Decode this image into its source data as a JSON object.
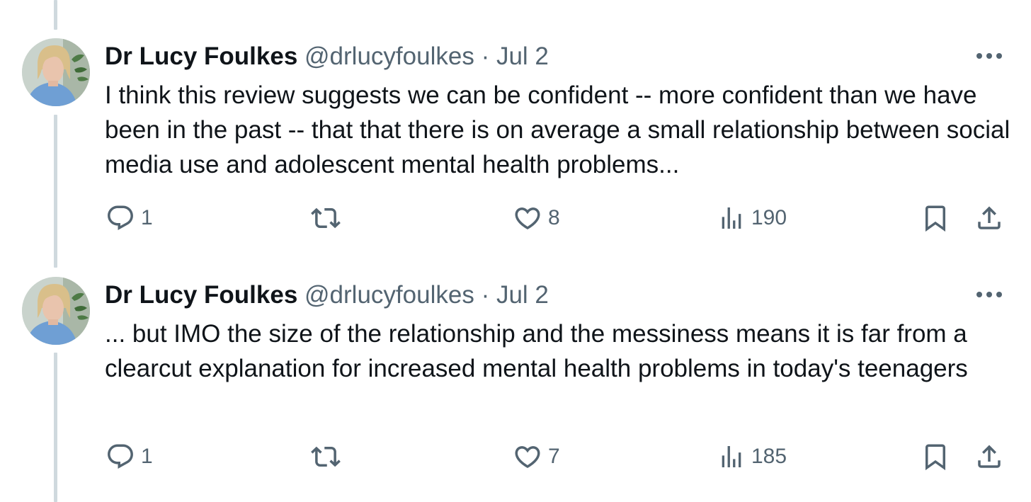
{
  "colors": {
    "text_primary": "#0f1419",
    "text_secondary": "#536471",
    "thread_line": "#cfd9de",
    "background": "#ffffff"
  },
  "icons": {
    "reply": "reply-icon",
    "retweet": "retweet-icon",
    "like": "heart-icon",
    "views": "views-icon",
    "bookmark": "bookmark-icon",
    "share": "share-icon",
    "more": "more-icon"
  },
  "tweets": [
    {
      "author_name": "Dr Lucy Foulkes",
      "handle": "@drlucyfoulkes",
      "separator": "·",
      "date": "Jul 2",
      "text": "I think this review suggests we can be confident -- more confident than we have been in the past -- that that there is on average a small relationship between social media use and adolescent mental health problems...",
      "replies": "1",
      "retweets": "",
      "likes": "8",
      "views": "190"
    },
    {
      "author_name": "Dr Lucy Foulkes",
      "handle": "@drlucyfoulkes",
      "separator": "·",
      "date": "Jul 2",
      "text": "... but IMO the size of the relationship and the messiness means it is far from a clearcut explanation for increased mental health problems in today's teenagers",
      "replies": "1",
      "retweets": "",
      "likes": "7",
      "views": "185"
    }
  ]
}
